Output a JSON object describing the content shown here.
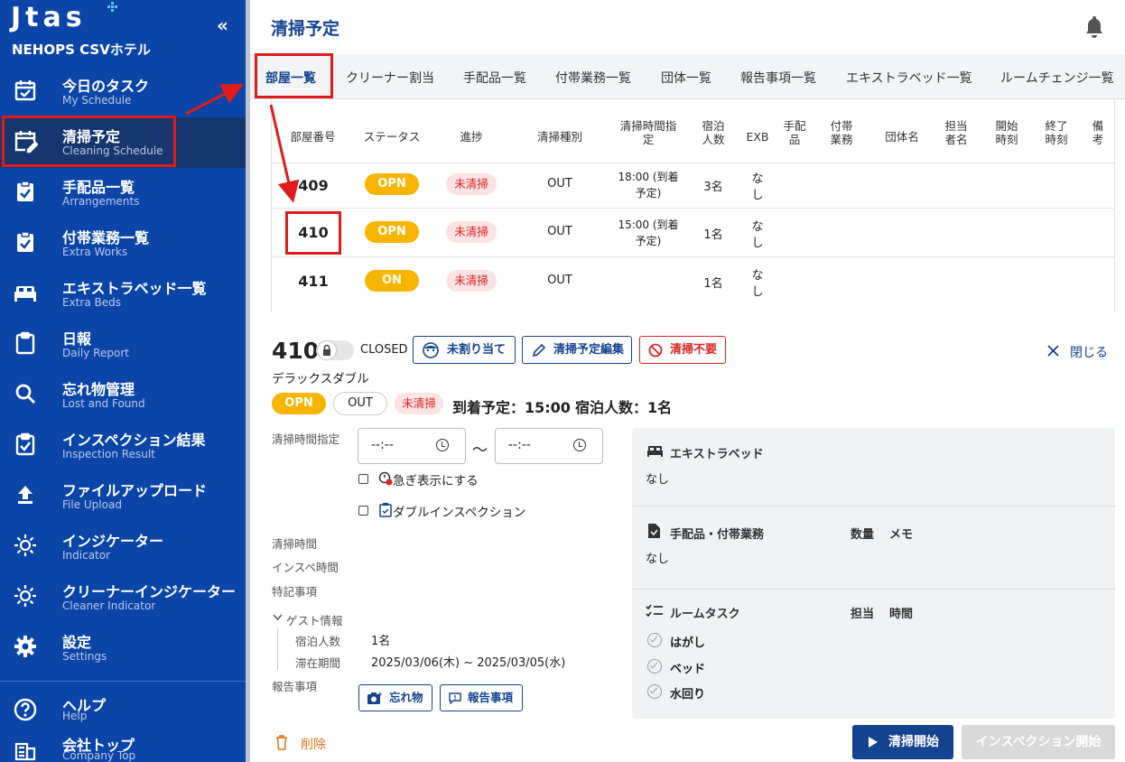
{
  "sidebar": {
    "logo": "Jtas",
    "hotel": "NEHOPS CSVホテル",
    "collapse": "«",
    "items": [
      {
        "jp": "今日のタスク",
        "en": "My Schedule",
        "icon": "calendar-check-icon"
      },
      {
        "jp": "清掃予定",
        "en": "Cleaning Schedule",
        "icon": "calendar-edit-icon"
      },
      {
        "jp": "手配品一覧",
        "en": "Arrangements",
        "icon": "clipboard-check-icon"
      },
      {
        "jp": "付帯業務一覧",
        "en": "Extra Works",
        "icon": "clipboard-check-icon"
      },
      {
        "jp": "エキストラベッド一覧",
        "en": "Extra Beds",
        "icon": "bed-icon"
      },
      {
        "jp": "日報",
        "en": "Daily Report",
        "icon": "clipboard-icon"
      },
      {
        "jp": "忘れ物管理",
        "en": "Lost and Found",
        "icon": "search-icon"
      },
      {
        "jp": "インスペクション結果",
        "en": "Inspection Result",
        "icon": "clipboard-check-icon"
      },
      {
        "jp": "ファイルアップロード",
        "en": "File Upload",
        "icon": "upload-icon"
      },
      {
        "jp": "インジケーター",
        "en": "Indicator",
        "icon": "sun-icon"
      },
      {
        "jp": "クリーナーインジケーター",
        "en": "Cleaner Indicator",
        "icon": "sun-icon"
      },
      {
        "jp": "設定",
        "en": "Settings",
        "icon": "gear-icon"
      }
    ],
    "bottom": [
      {
        "jp": "ヘルプ",
        "en": "Help",
        "icon": "help-icon"
      },
      {
        "jp": "会社トップ",
        "en": "Company Top",
        "icon": "building-icon"
      }
    ],
    "colors": {
      "bg": "#0c45a8",
      "active": "#15366f"
    }
  },
  "header": {
    "title": "清掃予定",
    "bell_icon": "bell-icon"
  },
  "tabs": [
    "部屋一覧",
    "クリーナー割当",
    "手配品一覧",
    "付帯業務一覧",
    "団体一覧",
    "報告事項一覧",
    "エキストラベッド一覧",
    "ルームチェンジ一覧"
  ],
  "table": {
    "columns": [
      "部屋番号",
      "ステータス",
      "進捗",
      "清掃種別",
      "清掃時間指定",
      "宿泊人数",
      "EXB",
      "手配品",
      "付帯業務",
      "団体名",
      "担当者名",
      "開始時刻",
      "終了時刻",
      "備考"
    ],
    "rows": [
      {
        "room": "409",
        "status": "OPN",
        "progress": "未清掃",
        "type": "OUT",
        "time1": "18:00 (到着",
        "time2": "予定)",
        "guests": "3名",
        "exb1": "な",
        "exb2": "し"
      },
      {
        "room": "410",
        "status": "OPN",
        "progress": "未清掃",
        "type": "OUT",
        "time1": "15:00 (到着",
        "time2": "予定)",
        "guests": "1名",
        "exb1": "な",
        "exb2": "し"
      },
      {
        "room": "411",
        "status": "ON",
        "progress": "未清掃",
        "type": "OUT",
        "time1": "",
        "time2": "",
        "guests": "1名",
        "exb1": "な",
        "exb2": "し"
      }
    ]
  },
  "detail": {
    "room": "410",
    "closed": "CLOSED",
    "btn_unassigned": "未割り当て",
    "btn_edit": "清掃予定編集",
    "btn_noclean": "清掃不要",
    "close": "閉じる",
    "room_type": "デラックスダブル",
    "status": "OPN",
    "type": "OUT",
    "progress": "未清掃",
    "arrival": "到着予定：15:00",
    "guests": "宿泊人数：1名",
    "labels": {
      "time_spec": "清掃時間指定",
      "clean_time": "清掃時間",
      "insp_time": "インスペ時間",
      "notes": "特記事項",
      "guest_info": "ゲスト情報",
      "guest_count": "宿泊人数",
      "stay": "滞在期間",
      "report": "報告事項"
    },
    "time_from": "--:--",
    "tilde": "〜",
    "time_to": "--:--",
    "urgent": "急ぎ表示にする",
    "double_insp": "ダブルインスペクション",
    "guest_count_val": "1名",
    "stay_val": "2025/03/06(木) ~ 2025/03/05(水)",
    "btn_lost": "忘れ物",
    "btn_report": "報告事項",
    "delete": "削除",
    "start": "清掃開始",
    "insp_start": "インスペクション開始"
  },
  "panel": {
    "exb_title": "エキストラベッド",
    "exb_val": "なし",
    "arr_title": "手配品・付帯業務",
    "arr_qty": "数量",
    "arr_memo": "メモ",
    "arr_val": "なし",
    "task_title": "ルームタスク",
    "task_assignee": "担当",
    "task_time": "時間",
    "tasks": [
      "はがし",
      "ベッド",
      "水回り"
    ]
  }
}
